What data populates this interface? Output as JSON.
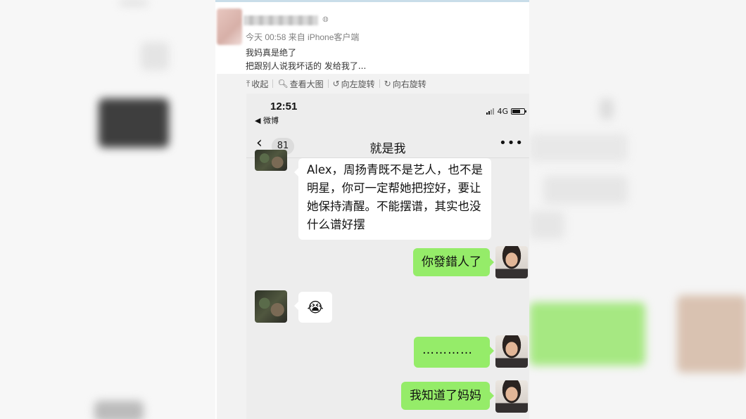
{
  "post": {
    "meta": "今天 00:58 来自 iPhone客户端",
    "text_line1": "我妈真是绝了",
    "text_line2": "把跟别人说我坏话的 发给我了..."
  },
  "toolbar": {
    "collapse": "收起",
    "view_large": "查看大图",
    "rotate_left": "向左旋转",
    "rotate_right": "向右旋转"
  },
  "phone": {
    "time": "12:51",
    "back_app": "◀ 微博",
    "network": "4G",
    "unread_count": "81",
    "chat_title": "就是我",
    "messages": [
      {
        "from": "contact",
        "text": "Alex，周扬青既不是艺人，也不是明星，你可一定帮她把控好，要让她保持清醒。不能摆谱，其实也没什么谱好摆"
      },
      {
        "from": "me",
        "text": "你發錯人了"
      },
      {
        "from": "contact",
        "text": "😭"
      },
      {
        "from": "me",
        "text": "…………"
      },
      {
        "from": "me",
        "text": "我知道了妈妈"
      }
    ]
  },
  "colors": {
    "bubble_green": "#95ec69",
    "bubble_white": "#ffffff",
    "chat_bg": "#ededed"
  }
}
